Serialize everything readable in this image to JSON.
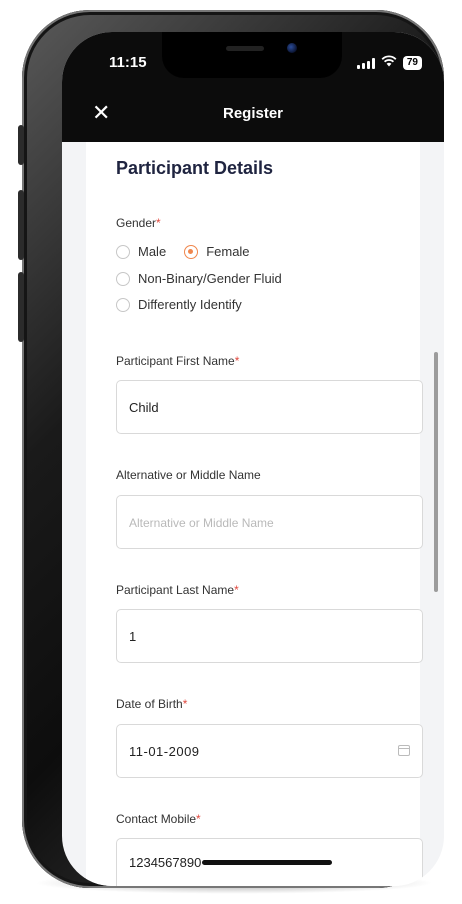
{
  "status_bar": {
    "time": "11:15",
    "battery": "79"
  },
  "header": {
    "close_icon": "close-icon",
    "title": "Register"
  },
  "section": {
    "title": "Participant Details"
  },
  "gender": {
    "label": "Gender",
    "required_mark": "*",
    "options": [
      {
        "label": "Male",
        "selected": false
      },
      {
        "label": "Female",
        "selected": true
      },
      {
        "label": "Non-Binary/Gender Fluid",
        "selected": false
      },
      {
        "label": "Differently Identify",
        "selected": false
      }
    ]
  },
  "fields": {
    "first_name": {
      "label": "Participant First Name",
      "required_mark": "*",
      "value": "Child"
    },
    "middle_name": {
      "label": "Alternative or Middle Name",
      "placeholder": "Alternative or Middle Name",
      "value": ""
    },
    "last_name": {
      "label": "Participant Last Name",
      "required_mark": "*",
      "value": "1"
    },
    "dob": {
      "label": "Date of Birth",
      "required_mark": "*",
      "value": "11-01-2009",
      "icon": "calendar-icon"
    },
    "mobile": {
      "label": "Contact Mobile",
      "required_mark": "*",
      "value": "1234567890"
    }
  },
  "colors": {
    "accent": "#f0864c",
    "required": "#e0483e",
    "header_bg": "#0c0c0c"
  }
}
